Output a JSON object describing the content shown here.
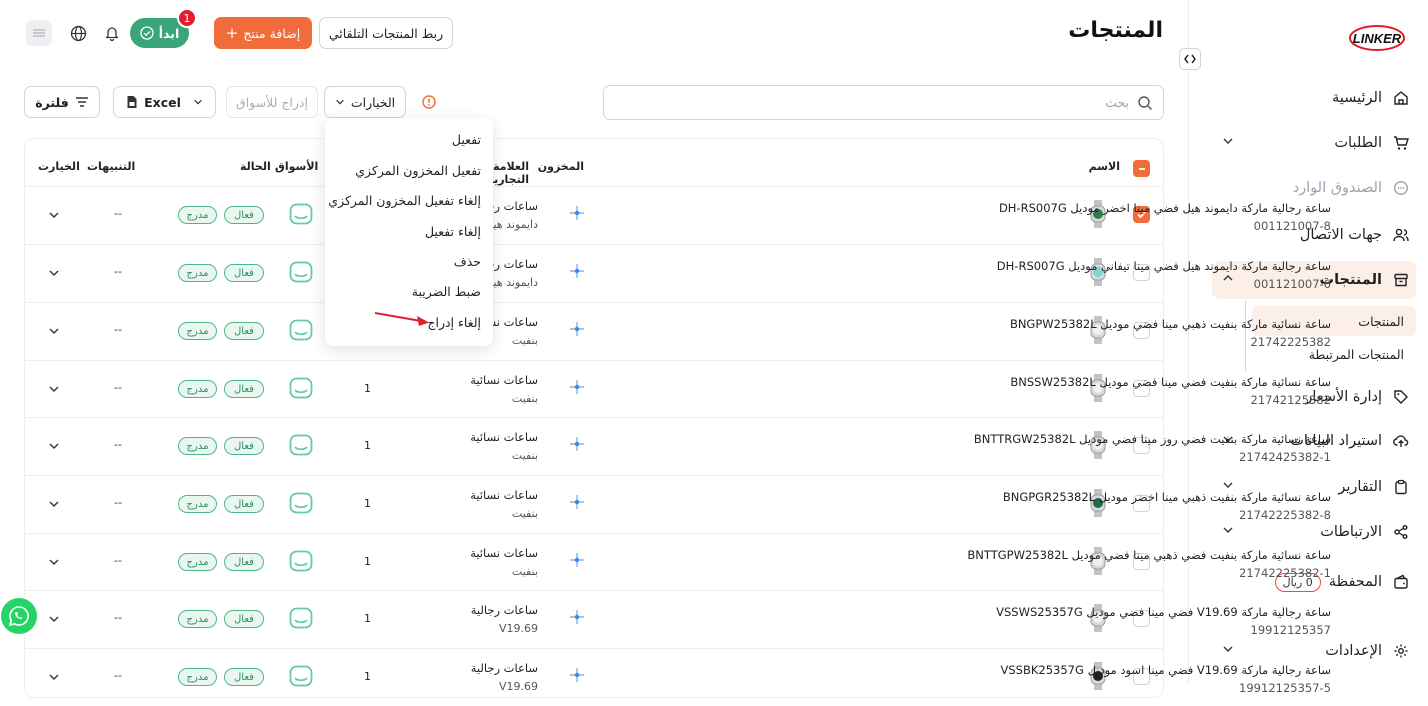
{
  "sidebar": {
    "logo_text": "LINKER",
    "items": [
      {
        "label": "الرئيسية"
      },
      {
        "label": "الطلبات"
      },
      {
        "label": "الصندوق الوارد"
      },
      {
        "label": "جهات الاتصال"
      },
      {
        "label": "المنتجات"
      },
      {
        "label": "إدارة الأسعار"
      },
      {
        "label": "استيراد البيانات"
      },
      {
        "label": "التقارير"
      },
      {
        "label": "الارتباطات"
      },
      {
        "label": "المحفظة"
      },
      {
        "label": "الإعدادات"
      }
    ],
    "sub_items": [
      {
        "label": "المنتجات"
      },
      {
        "label": "المنتجات المرتبطة"
      }
    ],
    "wallet_balance": "0 ريال"
  },
  "header": {
    "title": "المنتجات",
    "auto_link_label": "ربط المنتجات التلقائي",
    "add_product_label": "إضافة منتج",
    "start_label": "ابدأ",
    "notification_count": "1"
  },
  "toolbar": {
    "search_placeholder": "بحث",
    "options_label": "الخيارات",
    "list_markets_label": "إدراج للأسواق",
    "excel_label": "Excel",
    "filter_label": "فلترة"
  },
  "dropdown": {
    "items": [
      {
        "label": "تفعيل"
      },
      {
        "label": "تفعيل المخزون المركزي"
      },
      {
        "label": "إلغاء تفعيل المخزون المركزي"
      },
      {
        "label": "إلغاء تفعيل"
      },
      {
        "label": "حذف"
      },
      {
        "label": "ضبط الضريبة"
      },
      {
        "label": "إلغاء إدراج"
      }
    ]
  },
  "table": {
    "headers": {
      "name": "الاسم",
      "stock": "المخزون",
      "brand": "العلامة التجارية",
      "markets": "الأسواق",
      "status": "الحالة",
      "alerts": "التنبيهات",
      "options": "الخيارت"
    },
    "rows": [
      {
        "name": "ساعة رجالية ماركة دايموند هيل فضي مينا اخضر موديل DH-RS007G",
        "sku": "001121007-8",
        "brand": "ساعات رجالية",
        "sub": "دايموند هيل",
        "qty": "",
        "status": "فعال",
        "listed": "مدرج",
        "alerts": "--",
        "checked": true,
        "dial": "#2e7d4f"
      },
      {
        "name": "ساعة رجالية ماركة دايموند هيل فضي مينا تيفاني موديل DH-RS007G",
        "sku": "001121007-6",
        "brand": "ساعات رجالية",
        "sub": "دايموند هيل",
        "qty": "",
        "status": "فعال",
        "listed": "مدرج",
        "alerts": "--",
        "checked": false,
        "dial": "#7fd6d0"
      },
      {
        "name": "ساعة نسائية ماركة بنفيت ذهبي مينا فضي موديل BNGPW25382L",
        "sku": "21742225382",
        "brand": "ساعات نسائية",
        "sub": "بنفيت",
        "qty": "",
        "status": "فعال",
        "listed": "مدرج",
        "alerts": "--",
        "checked": false,
        "dial": "#f1f1f1"
      },
      {
        "name": "ساعة نسائية ماركة بنفيت فضي مينا فضي موديل BNSSW25382L",
        "sku": "21742125382",
        "brand": "ساعات نسائية",
        "sub": "بنفيت",
        "qty": "1",
        "status": "فعال",
        "listed": "مدرج",
        "alerts": "--",
        "checked": false,
        "dial": "#f1f1f1"
      },
      {
        "name": "ساعة نسائية ماركة بنفيت فضي روز مينا فضي موديل BNTTRGW25382L",
        "sku": "21742425382-1",
        "brand": "ساعات نسائية",
        "sub": "بنفيت",
        "qty": "1",
        "status": "فعال",
        "listed": "مدرج",
        "alerts": "--",
        "checked": false,
        "dial": "#f1f1f1"
      },
      {
        "name": "ساعة نسائية ماركة بنفيت ذهبي مينا اخضر موديل BNGPGR25382L",
        "sku": "21742225382-8",
        "brand": "ساعات نسائية",
        "sub": "بنفيت",
        "qty": "1",
        "status": "فعال",
        "listed": "مدرج",
        "alerts": "--",
        "checked": false,
        "dial": "#1f6b45"
      },
      {
        "name": "ساعة نسائية ماركة بنفيت فضي ذهبي مينا فضي موديل BNTTGPW25382L",
        "sku": "21742225382-1",
        "brand": "ساعات نسائية",
        "sub": "بنفيت",
        "qty": "1",
        "status": "فعال",
        "listed": "مدرج",
        "alerts": "--",
        "checked": false,
        "dial": "#f1f1f1"
      },
      {
        "name": "ساعة رجالية ماركة V19.69 فضي مينا فضي موديل VSSWS25357G",
        "sku": "19912125357",
        "brand": "ساعات رجالية",
        "sub": "V19.69",
        "qty": "1",
        "status": "فعال",
        "listed": "مدرج",
        "alerts": "--",
        "checked": false,
        "dial": "#f1f1f1"
      },
      {
        "name": "ساعة رجالية ماركة V19.69 فضي مينا اسود موديل VSSBK25357G",
        "sku": "19912125357-5",
        "brand": "ساعات رجالية",
        "sub": "V19.69",
        "qty": "1",
        "status": "فعال",
        "listed": "مدرج",
        "alerts": "--",
        "checked": false,
        "dial": "#222222"
      }
    ]
  },
  "colors": {
    "accent": "#f26b3a",
    "green": "#3aa57a",
    "badge": "#e11d2e"
  }
}
